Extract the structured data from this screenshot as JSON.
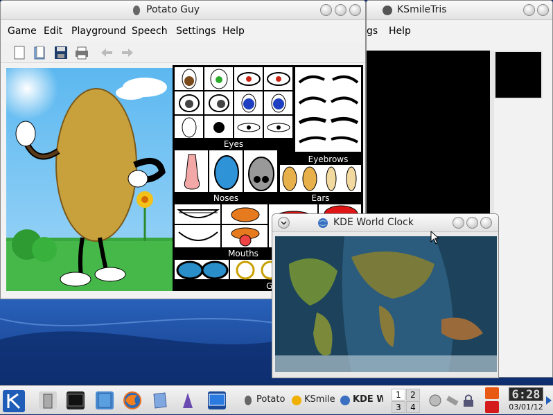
{
  "potato": {
    "title": "Potato Guy",
    "menu": [
      "Game",
      "Edit",
      "Playground",
      "Speech",
      "Settings",
      "Help"
    ],
    "sections": {
      "eyes": "Eyes",
      "eyebrows": "Eyebrows",
      "noses": "Noses",
      "ears": "Ears",
      "mouths": "Mouths",
      "goodies": "Goodi"
    }
  },
  "ksmile": {
    "title": "KSmileTris",
    "menu_partial": "gs",
    "menu_help": "Help"
  },
  "worldclock": {
    "title": "KDE World Clock"
  },
  "taskbar": {
    "tasks": [
      "Potato",
      "KSmile",
      "KDE W"
    ],
    "pager": [
      "1",
      "2",
      "3",
      "4"
    ],
    "clock_time": "6:28",
    "clock_date": "03/01/12"
  },
  "colors": {
    "sky": "#5fb0ea",
    "grass": "#2fb53a",
    "potato": "#c8a03c",
    "kde_blue": "#1f5db8"
  }
}
